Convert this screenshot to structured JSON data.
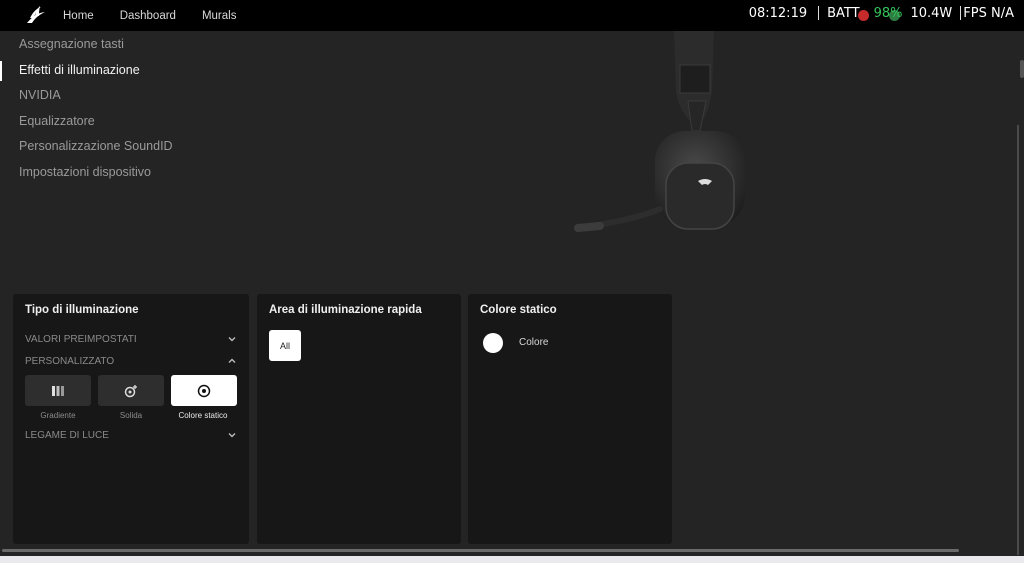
{
  "topnav": {
    "items": [
      "Home",
      "Dashboard",
      "Murals"
    ]
  },
  "hud": {
    "time": "08:12:19",
    "batt_label": "BATT",
    "batt_value": "98%",
    "power": "10.4W",
    "fps": "FPS N/A",
    "colors": {
      "green": "#35c45a",
      "red": "#c62b2b"
    }
  },
  "sidebar": {
    "items": [
      "Assegnazione tasti",
      "Effetti di illuminazione",
      "NVIDIA",
      "Equalizzatore",
      "Personalizzazione SoundID",
      "Impostazioni dispositivo"
    ],
    "active_index": 1
  },
  "lighting_type": {
    "title": "Tipo di illuminazione",
    "presets": "VALORI PREIMPOSTATI",
    "custom": "PERSONALIZZATO",
    "light_link": "LEGAME DI LUCE",
    "types": [
      {
        "label": "Gradiente",
        "icon": "gradient-icon"
      },
      {
        "label": "Solida",
        "icon": "solid-color-icon"
      },
      {
        "label": "Colore statico",
        "icon": "static-color-icon"
      }
    ],
    "selected_index": 2
  },
  "quick_area": {
    "title": "Area di illuminazione rapida",
    "all": "All"
  },
  "static_color": {
    "title": "Colore statico",
    "color_label": "Colore",
    "color_value": "#ffffff"
  }
}
